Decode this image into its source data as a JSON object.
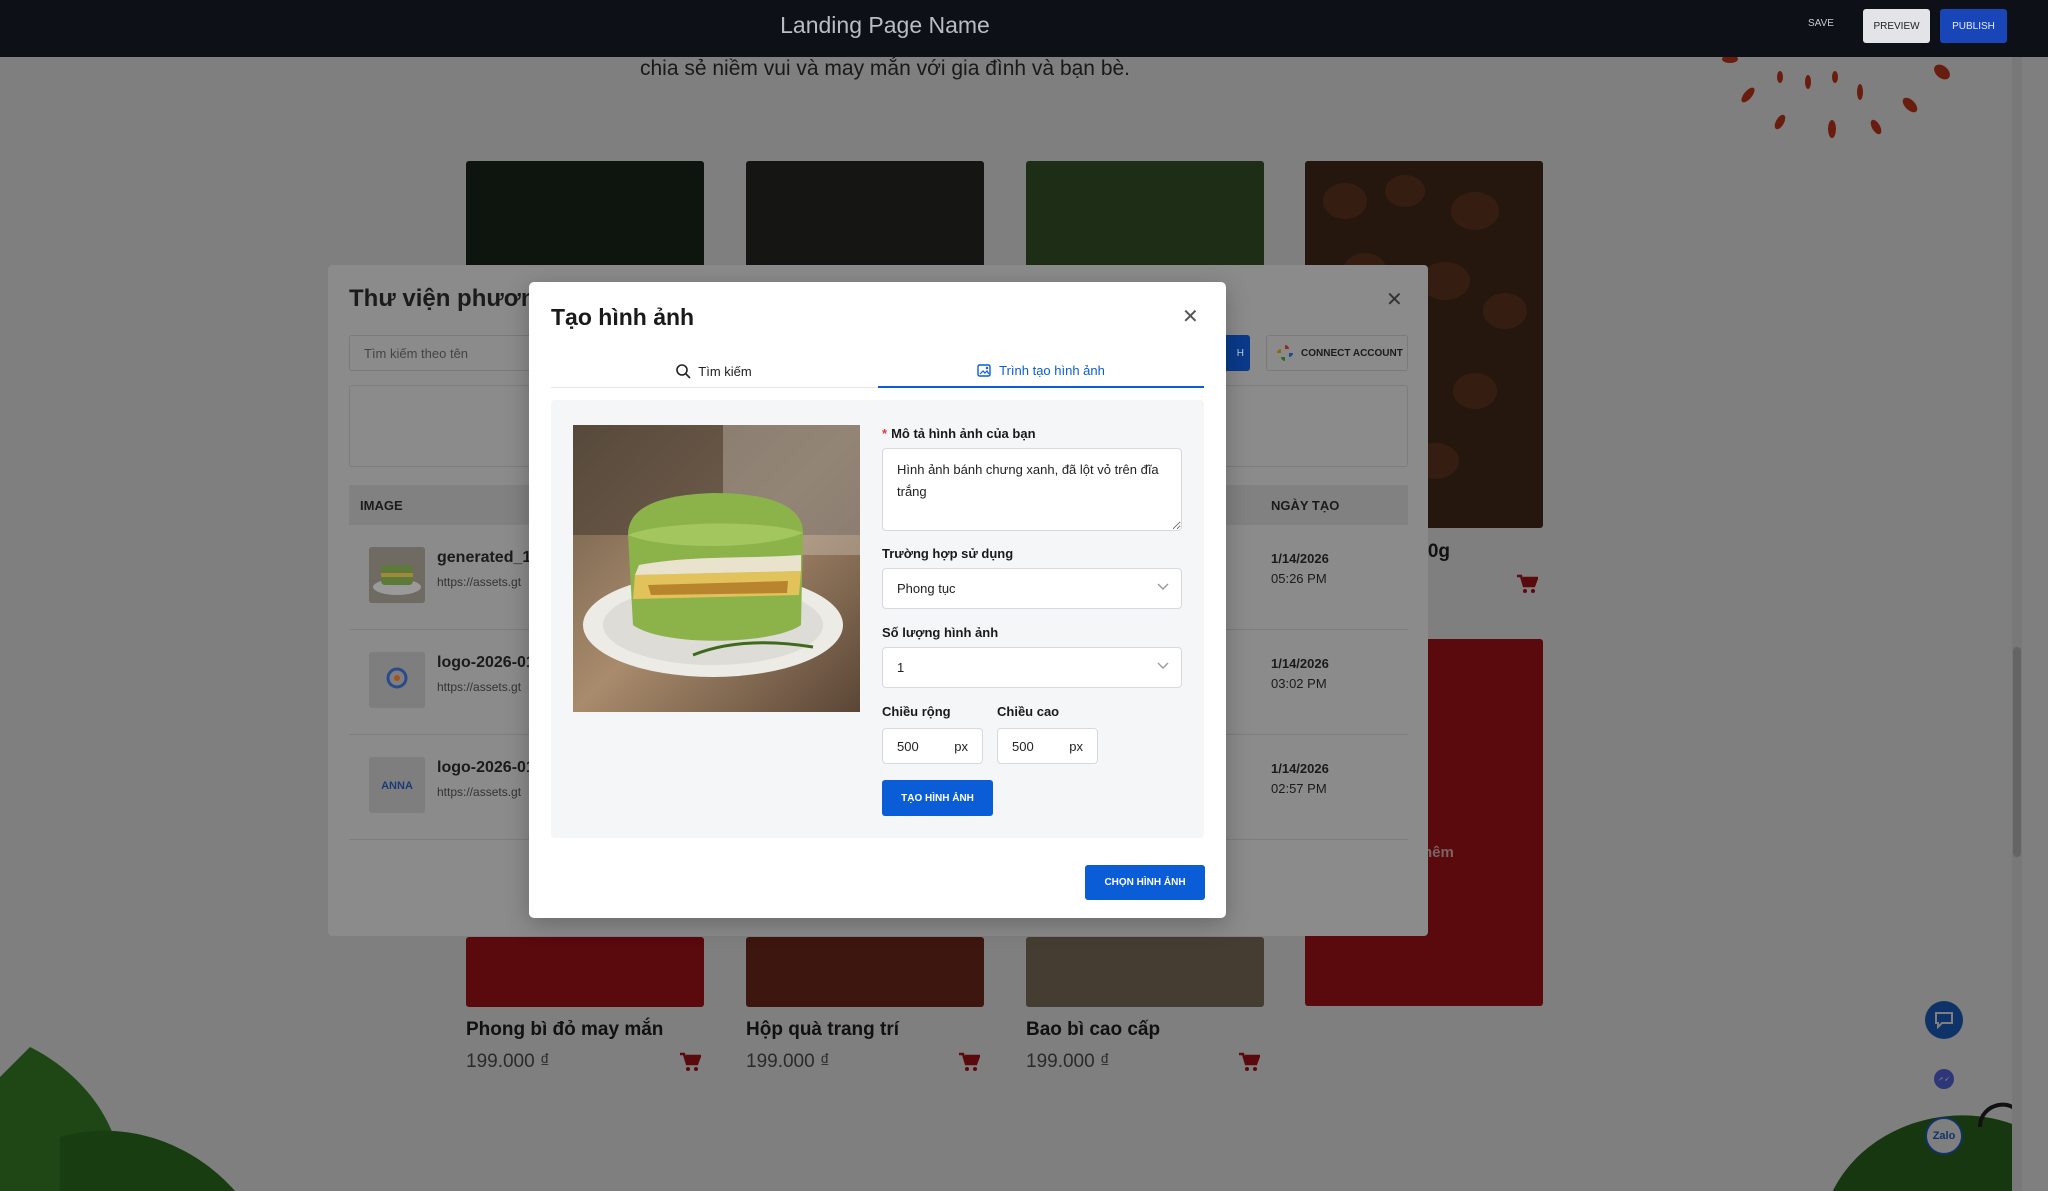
{
  "topbar": {
    "title": "Landing Page Name",
    "save_label": "SAVE",
    "preview_label": "PREVIEW",
    "publish_label": "PUBLISH"
  },
  "page": {
    "tagline": "chia sẻ niềm vui và may mắn với gia đình và bạn bè.",
    "partial_price": ".00g",
    "promo_text": "hêm",
    "products": [
      {
        "name": "Phong bì đỏ may mắn",
        "price": "199.000 ₫"
      },
      {
        "name": "Hộp quà trang trí",
        "price": "199.000 ₫"
      },
      {
        "name": "Bao bì cao cấp",
        "price": "199.000 ₫"
      }
    ],
    "zalo_label": "Zalo"
  },
  "library": {
    "title": "Thư viện phương",
    "search_placeholder": "Tìm kiếm theo tên",
    "blue_button_partial": "H",
    "connect_label": "CONNECT ACCOUNT",
    "col_image": "IMAGE",
    "col_date": "NGÀY TẠO",
    "rows": [
      {
        "name": "generated_1",
        "url": "https://assets.gt",
        "date": "1/14/2026",
        "time": "05:26 PM"
      },
      {
        "name": "logo-2026-01",
        "url": "https://assets.gt",
        "date": "1/14/2026",
        "time": "03:02 PM"
      },
      {
        "name": "logo-2026-01",
        "url": "https://assets.gt",
        "date": "1/14/2026",
        "time": "02:57 PM"
      }
    ]
  },
  "modal": {
    "title": "Tạo hình ảnh",
    "tab_search": "Tìm kiếm",
    "tab_generator": "Trình tạo hình ảnh",
    "desc_label": "Mô tả hình ảnh của bạn",
    "desc_value": "Hình ảnh bánh chưng xanh, đã lột vỏ trên đĩa trắng",
    "usecase_label": "Trường hợp sử dụng",
    "usecase_value": "Phong tục",
    "count_label": "Số lượng hình ảnh",
    "count_value": "1",
    "width_label": "Chiều rộng",
    "width_value": "500",
    "height_label": "Chiều cao",
    "height_value": "500",
    "unit": "px",
    "generate_label": "TẠO HÌNH ẢNH",
    "choose_label": "CHỌN HÌNH ẢNH"
  }
}
